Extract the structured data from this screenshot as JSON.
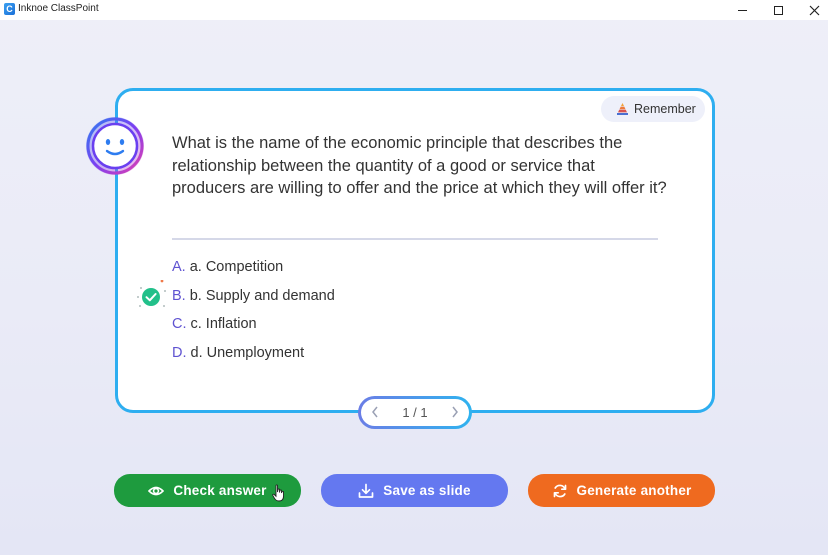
{
  "window": {
    "app_icon_letter": "C",
    "title": "Inknoe ClassPoint"
  },
  "card": {
    "level_badge": "Remember",
    "question": "What is the name of the economic principle that describes the relationship between the quantity of a good or service that producers are willing to offer and the price at which they will offer it?",
    "options": [
      {
        "letter": "A.",
        "text": "a. Competition",
        "correct": false
      },
      {
        "letter": "B.",
        "text": "b. Supply and demand",
        "correct": true
      },
      {
        "letter": "C.",
        "text": "c. Inflation",
        "correct": false
      },
      {
        "letter": "D.",
        "text": "d. Unemployment",
        "correct": false
      }
    ]
  },
  "pager": {
    "text": "1 / 1",
    "prev_icon": "chevron-left-icon",
    "next_icon": "chevron-right-icon"
  },
  "actions": {
    "check_label": "Check answer",
    "save_label": "Save as slide",
    "generate_label": "Generate another"
  },
  "colors": {
    "card_border": "#2eaef0",
    "option_letter": "#5f53d1",
    "check_button": "#1e9b3e",
    "save_button": "#6478f0",
    "generate_button": "#ef6a1f",
    "correct_mark": "#22c08a"
  }
}
